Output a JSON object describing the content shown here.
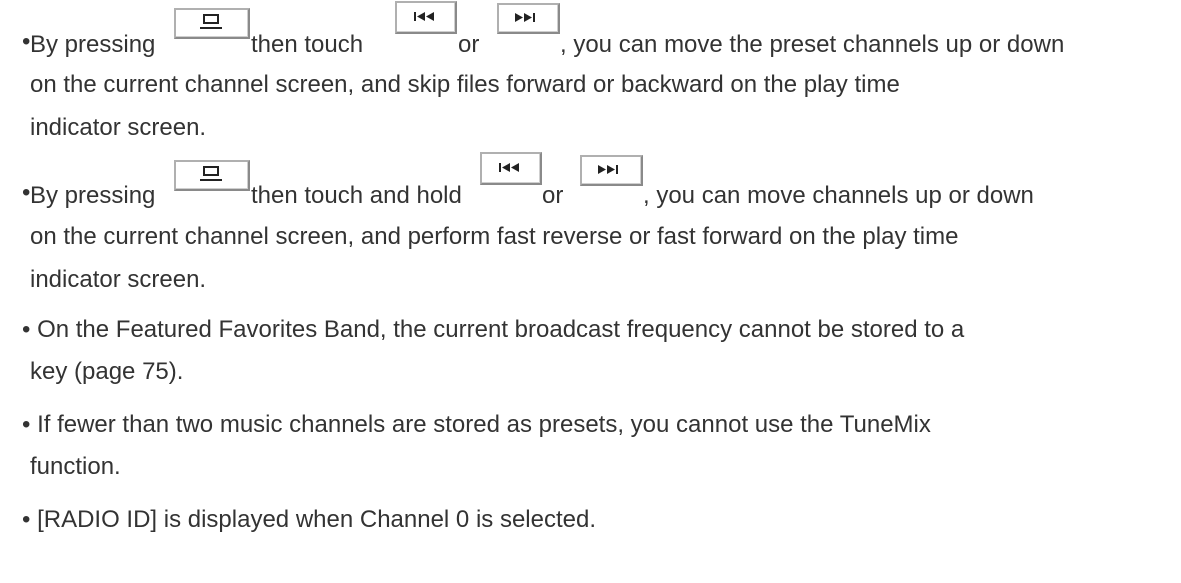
{
  "items": [
    {
      "bullet": "•",
      "line1": {
        "part1": "By pressing",
        "part2": "then touch",
        "part3": "or",
        "part4": ", you can move the preset channels up or down"
      },
      "line2": "on the current channel screen, and skip files forward or backward on the play time",
      "line3": "indicator screen."
    },
    {
      "bullet": "•",
      "line1": {
        "part1": "By pressing",
        "part2": "then touch and hold",
        "part3": "or",
        "part4": ", you can move channels up or down"
      },
      "line2": "on the current channel screen, and perform fast reverse or fast forward on the play time",
      "line3": "indicator screen."
    },
    {
      "line1": "• On the Featured Favorites Band, the current broadcast frequency cannot be stored to a",
      "line2": "key (page 75)."
    },
    {
      "line1": "• If fewer than two music channels are stored as presets, you cannot use the TuneMix",
      "line2": "function."
    },
    {
      "line1": "• [RADIO ID] is displayed when Channel 0 is selected."
    }
  ],
  "icons": {
    "display_button": "display-icon",
    "skip_back_button": "skip-back-icon",
    "skip_forward_button": "skip-forward-icon"
  }
}
